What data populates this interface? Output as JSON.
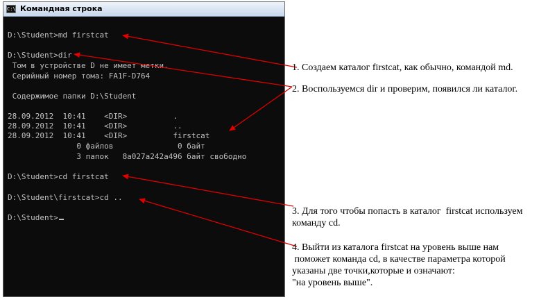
{
  "window": {
    "title": "Командная строка",
    "icon_text": "C:\\"
  },
  "console": {
    "lines": [
      "D:\\Student>md firstcat",
      "D:\\Student>dir",
      " Том в устройстве D не имеет метки.",
      " Серийный номер тома: FA1F-D764",
      " Содержимое папки D:\\Student",
      "28.09.2012  10:41    <DIR>          .",
      "28.09.2012  10:41    <DIR>          ..",
      "28.09.2012  10:41    <DIR>          firstcat",
      "               0 файлов              0 байт",
      "               3 папок   8a027a242a496 байт свободно",
      "D:\\Student>cd firstcat",
      "D:\\Student\\firstcat>cd ..",
      "D:\\Student>"
    ]
  },
  "annotations": {
    "note1": "1. Создаем каталог firstcat, как обычно, командой md.",
    "note2": "2. Воспользуемся dir и проверим, появился ли каталог.",
    "note3_line1": "3. Для того чтобы попасть в каталог  firstcat используем",
    "note3_line2": "команду cd.",
    "note4_line1": "4. Выйти из каталога firstcat на уровень выше нам",
    "note4_line2": " поможет команда cd, в качестве параметра которой",
    "note4_line3": "указаны две точки,которые и означают:",
    "note4_line4": "\"на уровень выше\"."
  },
  "colors": {
    "console_bg": "#0c0c0c",
    "console_text": "#c0c0c0",
    "arrow": "#e00000"
  }
}
